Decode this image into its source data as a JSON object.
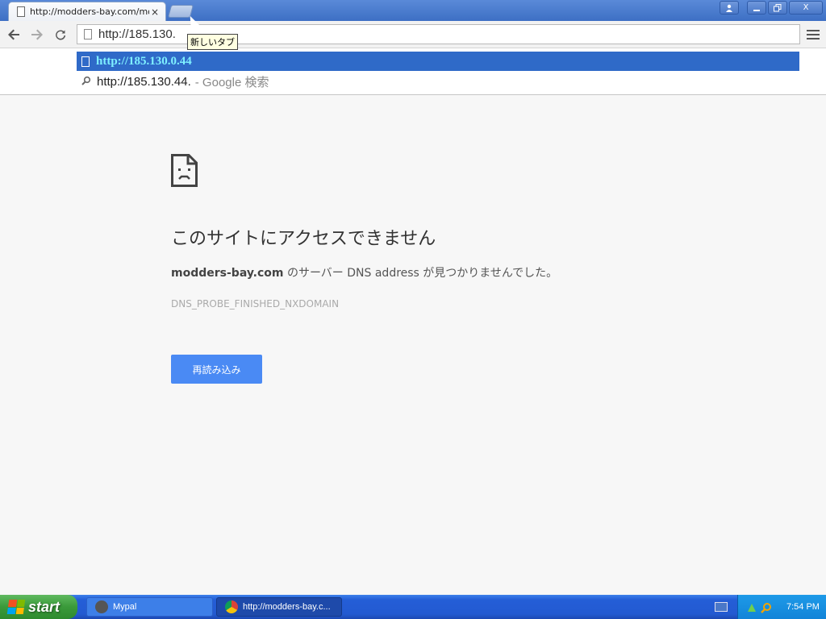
{
  "browser": {
    "tab": {
      "title": "http://modders-bay.com/mo",
      "close_glyph": "×"
    },
    "new_tab_tooltip": "新しいタブ",
    "window_buttons": {
      "profile": "profile-icon",
      "minimize": "minimize-icon",
      "restore": "restore-icon",
      "close_glyph": "X"
    },
    "omnibox": {
      "value": "http://185.130."
    },
    "suggestions": [
      {
        "text": "http://185.130.0.44",
        "icon": "page-icon",
        "selected": true
      },
      {
        "text": "http://185.130.44.",
        "suffix": "- Google 検索",
        "icon": "search-icon",
        "selected": false
      }
    ]
  },
  "error_page": {
    "icon": "sad-page-icon",
    "title": "このサイトにアクセスできません",
    "domain": "modders-bay.com",
    "description_rest": " のサーバー DNS address が見つかりませんでした。",
    "error_code": "DNS_PROBE_FINISHED_NXDOMAIN",
    "reload_label": "再読み込み"
  },
  "taskbar": {
    "start_label": "start",
    "tasks": [
      {
        "label": "Mypal",
        "icon": "mypal-icon"
      },
      {
        "label": "http://modders-bay.c...",
        "icon": "chrome-icon"
      }
    ],
    "clock": "7:54 PM"
  },
  "colors": {
    "accent": "#4a8af4",
    "selection": "#2f6ac8",
    "taskbar": "#245ed7",
    "start": "#3a9a3a"
  }
}
